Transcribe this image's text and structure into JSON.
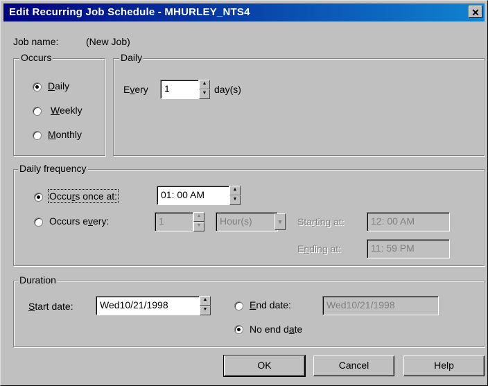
{
  "window": {
    "title": "Edit Recurring Job Schedule - MHURLEY_NTS4",
    "close_glyph": "✕"
  },
  "job": {
    "label": "Job name:",
    "value": "(New Job)"
  },
  "occurs": {
    "legend": "Occurs",
    "options": [
      {
        "label": "Daily",
        "selected": true
      },
      {
        "label": "Weekly",
        "selected": false
      },
      {
        "label": "Monthly",
        "selected": false
      }
    ]
  },
  "daily": {
    "legend": "Daily",
    "every_label": "Every",
    "every_value": "1",
    "unit_label": "day(s)"
  },
  "daily_frequency": {
    "legend": "Daily frequency",
    "once_label": "Occurs once at:",
    "once_value": "01: 00  AM",
    "every_label": "Occurs every:",
    "every_value": "1",
    "unit_value": "Hour(s)",
    "starting_label": "Starting at:",
    "starting_value": "12: 00  AM",
    "ending_label": "Ending at:",
    "ending_value": "11: 59  PM",
    "selected": "once"
  },
  "duration": {
    "legend": "Duration",
    "start_label": "Start date:",
    "start_value": "Wed10/21/1998",
    "end_label": "End date:",
    "end_value": "Wed10/21/1998",
    "no_end_label": "No end date",
    "selected": "no_end"
  },
  "buttons": {
    "ok": "OK",
    "cancel": "Cancel",
    "help": "Help"
  },
  "colors": {
    "face": "#c0c0c0",
    "title_start": "#000080",
    "title_end": "#1084d0"
  }
}
